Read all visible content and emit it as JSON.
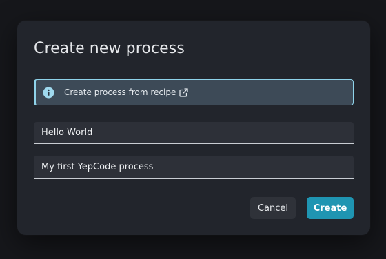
{
  "dialog": {
    "title": "Create new process",
    "banner": {
      "icon": "info-icon",
      "text": "Create process from recipe",
      "link_icon": "external-link-icon",
      "accent_color": "#8fd3ea"
    },
    "fields": {
      "name": {
        "value": "Hello World",
        "placeholder": ""
      },
      "description": {
        "value": "My first YepCode process",
        "placeholder": ""
      }
    },
    "buttons": {
      "cancel_label": "Cancel",
      "create_label": "Create",
      "create_color": "#1f95b2"
    }
  }
}
